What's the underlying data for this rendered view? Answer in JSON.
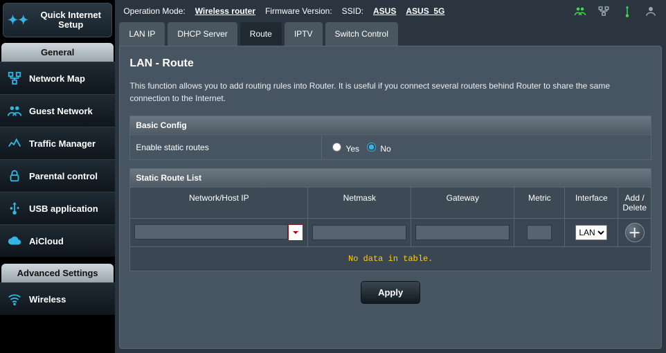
{
  "sidebar": {
    "quick_setup_line1": "Quick Internet",
    "quick_setup_line2": "Setup",
    "section_general": "General",
    "section_advanced": "Advanced Settings",
    "general_items": [
      {
        "label": "Network Map",
        "icon": "network-map-icon"
      },
      {
        "label": "Guest Network",
        "icon": "guest-network-icon"
      },
      {
        "label": "Traffic Manager",
        "icon": "traffic-manager-icon"
      },
      {
        "label": "Parental control",
        "icon": "parental-control-icon"
      },
      {
        "label": "USB application",
        "icon": "usb-app-icon"
      },
      {
        "label": "AiCloud",
        "icon": "aicloud-icon"
      }
    ],
    "advanced_items": [
      {
        "label": "Wireless",
        "icon": "wireless-icon"
      }
    ]
  },
  "topbar": {
    "operation_mode_label": "Operation Mode:",
    "operation_mode_value": "Wireless router",
    "firmware_label": "Firmware Version:",
    "ssid_label": "SSID:",
    "ssid_values": [
      "ASUS",
      "ASUS_5G"
    ]
  },
  "tabs": [
    {
      "label": "LAN IP",
      "active": false
    },
    {
      "label": "DHCP Server",
      "active": false
    },
    {
      "label": "Route",
      "active": true
    },
    {
      "label": "IPTV",
      "active": false
    },
    {
      "label": "Switch Control",
      "active": false
    }
  ],
  "panel": {
    "title": "LAN - Route",
    "description": "This function allows you to add routing rules into Router. It is useful if you connect several routers behind Router to share the same connection to the Internet.",
    "basic_config_header": "Basic Config",
    "enable_label": "Enable static routes",
    "yes_label": "Yes",
    "no_label": "No",
    "enable_value": "No",
    "list_header": "Static Route List",
    "columns": {
      "ip": "Network/Host IP",
      "mask": "Netmask",
      "gw": "Gateway",
      "metric": "Metric",
      "iface": "Interface",
      "action": "Add / Delete"
    },
    "input_row": {
      "ip": "",
      "mask": "",
      "gw": "",
      "metric": "",
      "iface_selected": "LAN",
      "iface_options": [
        "LAN"
      ]
    },
    "no_data": "No data in table.",
    "apply_label": "Apply"
  },
  "colors": {
    "accent": "#33b5e5",
    "warn": "#ffcc00"
  }
}
